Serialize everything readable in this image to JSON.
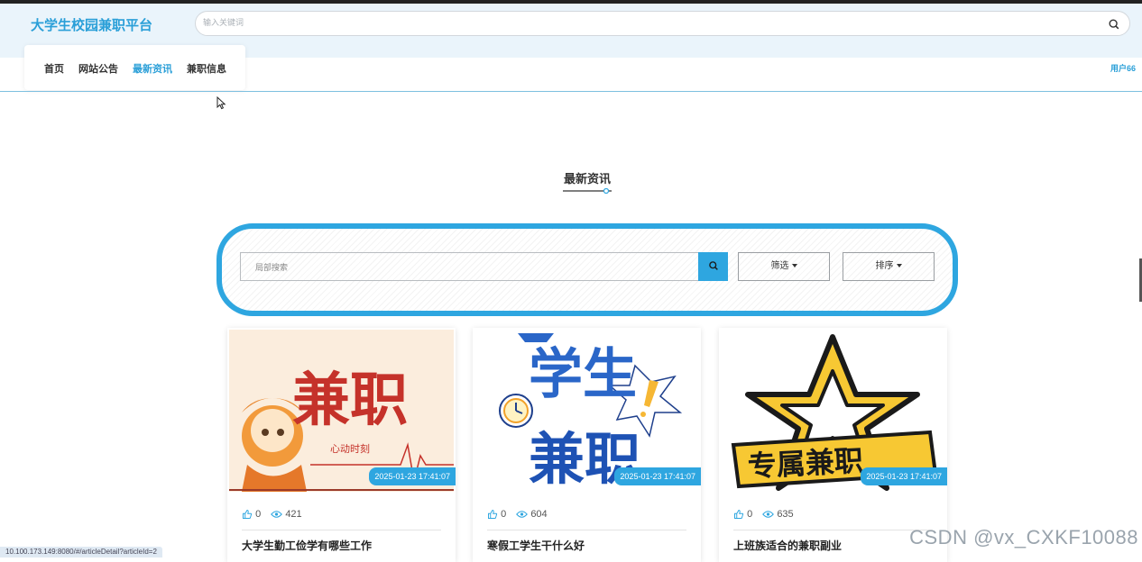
{
  "header": {
    "brand": "大学生校园兼职平台",
    "search_placeholder": "输入关键词",
    "user_link": "用户66"
  },
  "nav": {
    "items": [
      {
        "label": "首页"
      },
      {
        "label": "网站公告"
      },
      {
        "label": "最新资讯",
        "active": true
      },
      {
        "label": "兼职信息"
      }
    ]
  },
  "section": {
    "title": "最新资讯"
  },
  "filter": {
    "search_placeholder": "局部搜索",
    "filter_label": "筛选",
    "sort_label": "排序"
  },
  "cards": [
    {
      "title": "大学生勤工俭学有哪些工作",
      "date": "2025-01-23 17:41:07",
      "likes": "0",
      "views": "421",
      "image_text": "兼职",
      "image_subtext": "心动时刻"
    },
    {
      "title": "寒假工学生干什么好",
      "date": "2025-01-23 17:41:07",
      "likes": "0",
      "views": "604",
      "image_text_line1": "学生",
      "image_text_line2": "兼职"
    },
    {
      "title": "上班族适合的兼职副业",
      "date": "2025-01-23 17:41:07",
      "likes": "0",
      "views": "635",
      "image_text": "专属兼职"
    }
  ],
  "status_bar": {
    "url": "10.100.173.149:8080/#/articleDetail?articleId=2"
  },
  "watermark": "CSDN @vx_CXKF10088",
  "colors": {
    "accent": "#2ea6e0",
    "brand": "#2a9fd8",
    "header_bg": "#eaf4fb"
  }
}
